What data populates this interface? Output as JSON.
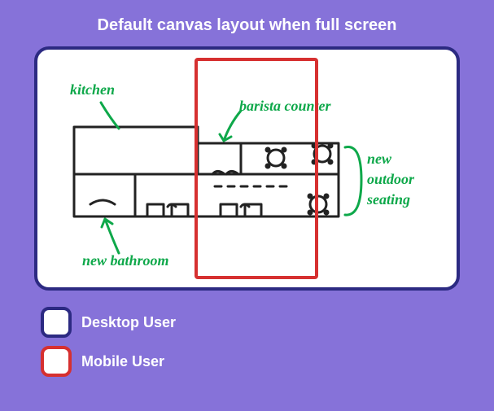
{
  "title": "Default canvas layout when full screen",
  "legend": {
    "desktop": "Desktop User",
    "mobile": "Mobile User"
  },
  "sketch": {
    "labels": {
      "kitchen": "kitchen",
      "barista": "barista counter",
      "outdoor1": "new",
      "outdoor2": "outdoor",
      "outdoor3": "seating",
      "bathroom": "new bathroom"
    }
  },
  "colors": {
    "bg": "#8672d9",
    "desktop_border": "#2c2a82",
    "mobile_border": "#d63030",
    "ink": "#0ea84a",
    "plan": "#222"
  }
}
